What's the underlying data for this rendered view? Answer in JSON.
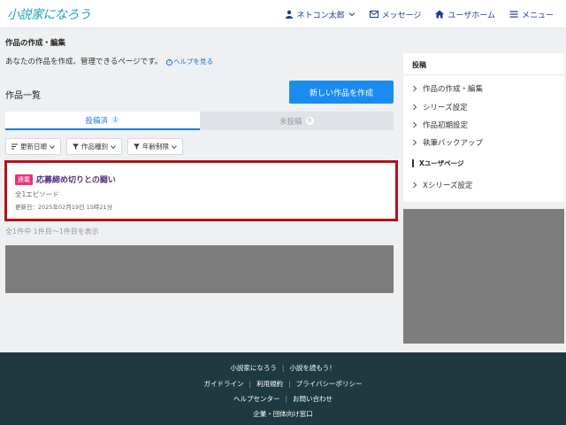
{
  "header": {
    "logo": "小説家になろう",
    "nav": [
      {
        "label": "ネトコン太郎",
        "icon": "user-icon"
      },
      {
        "label": "メッセージ",
        "icon": "mail-icon"
      },
      {
        "label": "ユーザホーム",
        "icon": "home-icon"
      },
      {
        "label": "メニュー",
        "icon": "menu-icon"
      }
    ]
  },
  "main": {
    "breadcrumb": "作品の作成・編集",
    "description": "あなたの作品を作成、管理できるページです。",
    "help_link": "ヘルプを見る",
    "list_title": "作品一覧",
    "new_button": "新しい作品を作成",
    "tabs": [
      {
        "label": "投稿済",
        "count": "1"
      },
      {
        "label": "未投稿",
        "count": "0"
      }
    ],
    "filters": [
      "更新日順",
      "作品種別",
      "年齢制限"
    ],
    "work": {
      "badge": "連載",
      "title": "応募締め切りとの闘い",
      "episodes": "全1エピソード",
      "updated": "更新日：2025年02月19日 15時21分"
    },
    "count_text": "全1件中 1件目〜1件目を表示"
  },
  "sidebar": {
    "heading": "投稿",
    "items": [
      "作品の作成・編集",
      "シリーズ設定",
      "作品初期設定",
      "執筆バックアップ"
    ],
    "section": "Xユーザページ",
    "section_items": [
      "Xシリーズ設定"
    ]
  },
  "footer": {
    "row1": [
      "小説家になろう",
      "小説を読もう！"
    ],
    "row2": [
      "ガイドライン",
      "利用規約",
      "プライバシーポリシー"
    ],
    "row3": [
      "ヘルプセンター",
      "お問い合わせ"
    ],
    "row4": [
      "企業・団体向け窓口"
    ]
  },
  "colors": {
    "accent": "#1a8cf0",
    "logo": "#1aa3b5",
    "nav": "#1a3e8c",
    "serial_badge": "#e8337a",
    "highlight_border": "#b5121b",
    "footer_bg": "#1e3a40"
  }
}
